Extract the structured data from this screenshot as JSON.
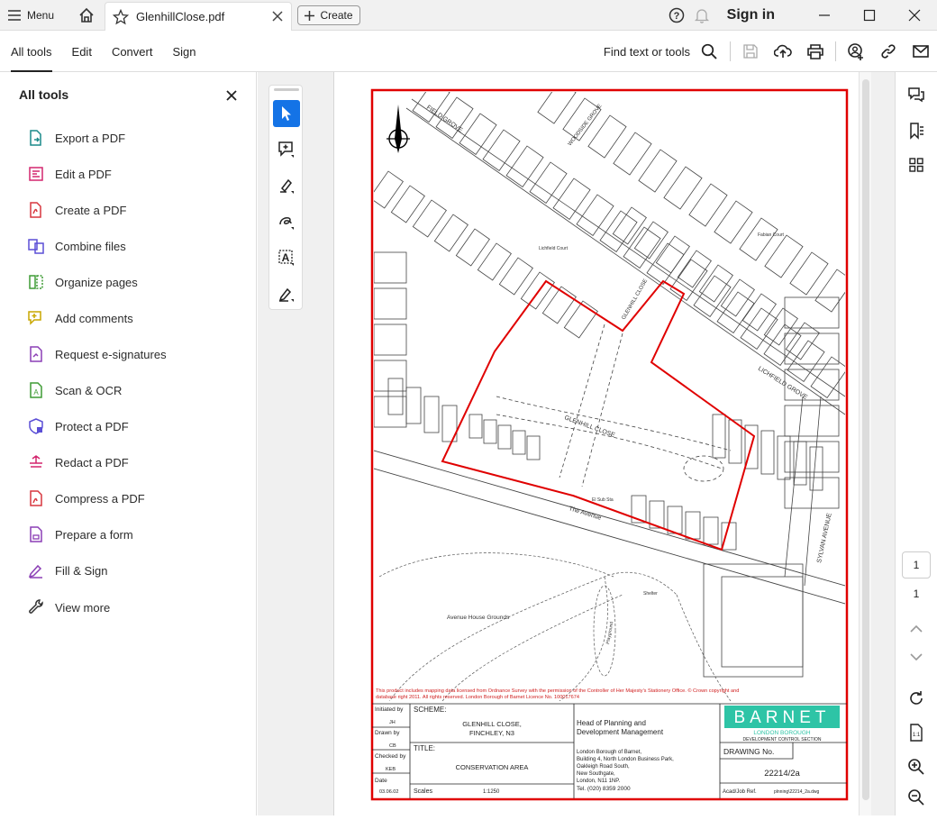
{
  "titlebar": {
    "menu_label": "Menu",
    "tab_name": "GlenhillClose.pdf",
    "create_label": "Create",
    "signin_label": "Sign in"
  },
  "toolbar": {
    "tabs": [
      "All tools",
      "Edit",
      "Convert",
      "Sign"
    ],
    "find_label": "Find text or tools"
  },
  "leftpanel": {
    "title": "All tools",
    "items": [
      {
        "label": "Export a PDF",
        "icon": "export-pdf-icon",
        "color": "#1a8a8a"
      },
      {
        "label": "Edit a PDF",
        "icon": "edit-pdf-icon",
        "color": "#d3266e"
      },
      {
        "label": "Create a PDF",
        "icon": "create-pdf-icon",
        "color": "#d7373f"
      },
      {
        "label": "Combine files",
        "icon": "combine-files-icon",
        "color": "#5b4fd6"
      },
      {
        "label": "Organize pages",
        "icon": "organize-pages-icon",
        "color": "#3f9c35"
      },
      {
        "label": "Add comments",
        "icon": "add-comments-icon",
        "color": "#c9a700"
      },
      {
        "label": "Request e-signatures",
        "icon": "request-esignatures-icon",
        "color": "#8b3fb5"
      },
      {
        "label": "Scan & OCR",
        "icon": "scan-ocr-icon",
        "color": "#3f9c35"
      },
      {
        "label": "Protect a PDF",
        "icon": "protect-pdf-icon",
        "color": "#5b4fd6"
      },
      {
        "label": "Redact a PDF",
        "icon": "redact-pdf-icon",
        "color": "#d3266e"
      },
      {
        "label": "Compress a PDF",
        "icon": "compress-pdf-icon",
        "color": "#d7373f"
      },
      {
        "label": "Prepare a form",
        "icon": "prepare-form-icon",
        "color": "#8b3fb5"
      },
      {
        "label": "Fill & Sign",
        "icon": "fill-sign-icon",
        "color": "#8b3fb5"
      },
      {
        "label": "View more",
        "icon": "wrench-icon",
        "color": "#333333"
      }
    ]
  },
  "navigation": {
    "page_number": "1",
    "page_count": "1"
  },
  "document": {
    "roads": {
      "field_grove": "FIELD GROVE",
      "woodside_grove": "WOODSIDE GROVE",
      "glenhill_close_north": "GLENHILL CLOSE",
      "glenhill_close": "GLENHILL CLOSE",
      "lichfield_grove": "LICHFIELD GROVE",
      "sylvan_avenue": "SYLVAN AVENUE",
      "the_avenue": "The Avenue"
    },
    "places": {
      "avenue_house_grounds": "Avenue House Grounds",
      "shelter": "Shelter",
      "playground": "Playground",
      "lichfield_court": "Lichfield Court",
      "fabian_court": "Fabian Court",
      "el_sub_sta": "El Sub Sta"
    },
    "copyright": "This product includes mapping data licensed from Ordnance Survey with the permission of the Controller of Her Majesty's Stationery Office. © Crown copyright and database right 2011. All rights reserved. London Borough of Barnet Licence No. 100017674",
    "titleblock": {
      "initiated_label": "Initiated by",
      "initiated_value": "JH",
      "drawn_label": "Drawn by",
      "drawn_value": "CB",
      "checked_label": "Checked by",
      "checked_value": "KEB",
      "date_label": "Date",
      "date_value": "03.06.02",
      "scheme_label": "SCHEME:",
      "scheme_value_1": "GLENHILL CLOSE,",
      "scheme_value_2": "FINCHLEY, N3",
      "title_label": "TITLE:",
      "title_value": "CONSERVATION AREA",
      "scales_label": "Scales",
      "scales_value": "1:1250",
      "head_1": "Head of Planning and",
      "head_2": "Development Management",
      "address": [
        "London Borough of Barnet,",
        "Building 4, North London Business Park,",
        "Oakleigh Road South,",
        "New Southgate,",
        "London, N11 1NP.",
        "Tel. (020) 8359 2000"
      ],
      "barnet": "BARNET",
      "barnet_sub": "LONDON BOROUGH",
      "barnet_section": "DEVELOPMENT CONTROL SECTION",
      "drawing_label": "DRAWING No.",
      "drawing_value": "22214/2a",
      "acad_label": "Acad/Job Ref.",
      "acad_value": "plnning\\22214_2a.dwg"
    }
  },
  "colors": {
    "accent": "#1473e6",
    "boundary": "#e00000",
    "barnet_teal": "#2ec4a6"
  }
}
